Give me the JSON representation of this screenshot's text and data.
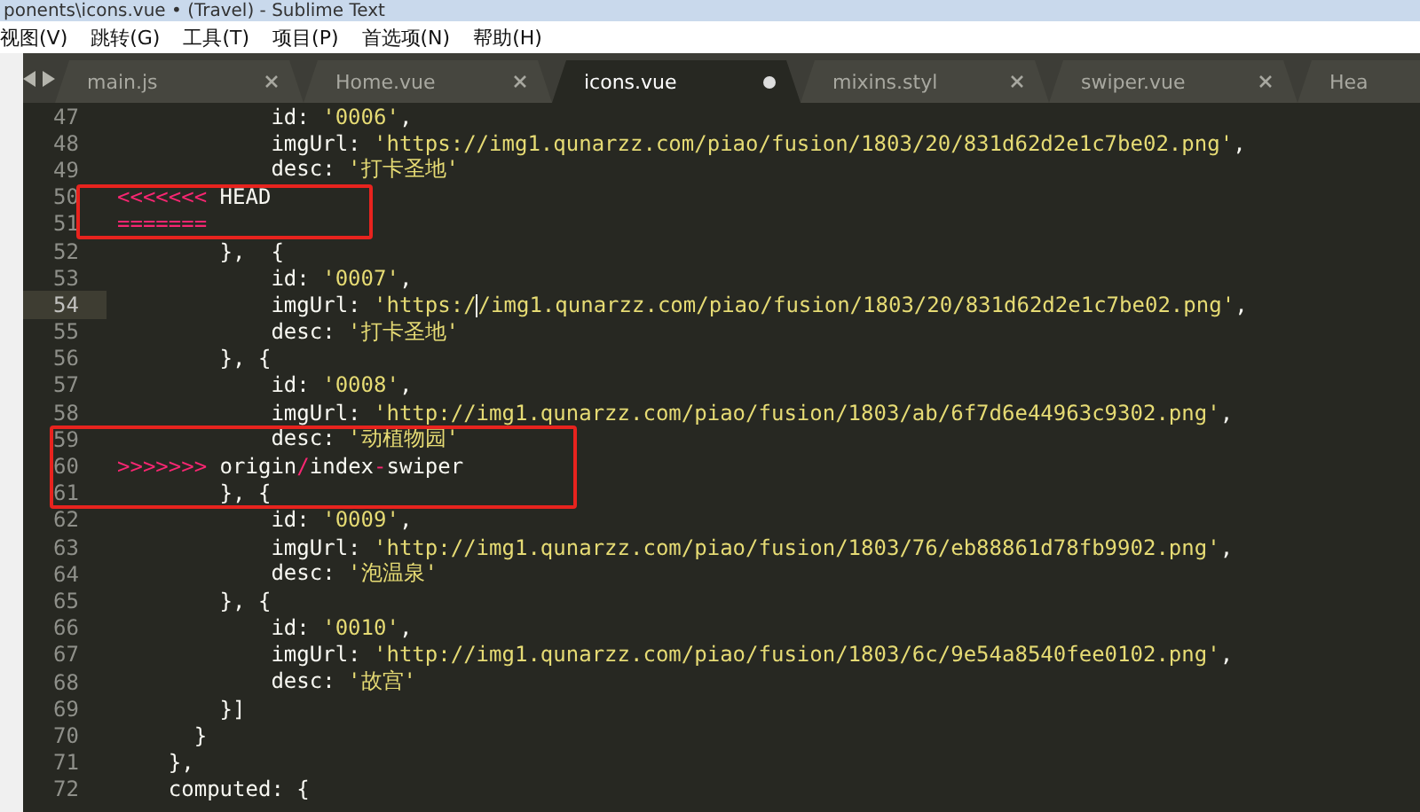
{
  "window": {
    "title": "ponents\\icons.vue • (Travel) - Sublime Text"
  },
  "menu": [
    {
      "label": "视图(V)"
    },
    {
      "label": "跳转(G)"
    },
    {
      "label": "工具(T)"
    },
    {
      "label": "项目(P)"
    },
    {
      "label": "首选项(N)"
    },
    {
      "label": "帮助(H)"
    }
  ],
  "tabs": [
    {
      "label": "main.js",
      "selected": false,
      "dirty": false
    },
    {
      "label": "Home.vue",
      "selected": false,
      "dirty": false
    },
    {
      "label": "icons.vue",
      "selected": true,
      "dirty": true
    },
    {
      "label": "mixins.styl",
      "selected": false,
      "dirty": false
    },
    {
      "label": "swiper.vue",
      "selected": false,
      "dirty": false
    },
    {
      "label": "Hea",
      "selected": false
    }
  ],
  "editor": {
    "blocks": [
      {
        "boxed": false,
        "lines": [
          {
            "number": "47",
            "current": false,
            "tokens": [
              {
                "text": "            id: ",
                "kind": "plain"
              },
              {
                "text": "'0006'",
                "kind": "string"
              },
              {
                "text": ",",
                "kind": "plain"
              }
            ]
          },
          {
            "number": "48",
            "current": false,
            "tokens": [
              {
                "text": "            imgUrl: ",
                "kind": "plain"
              },
              {
                "text": "'https://img1.qunarzz.com/piao/fusion/1803/20/831d62d2e1c7be02.png'",
                "kind": "string"
              },
              {
                "text": ",",
                "kind": "plain"
              }
            ]
          },
          {
            "number": "49",
            "current": false,
            "tokens": [
              {
                "text": "            desc: ",
                "kind": "plain"
              },
              {
                "text": "'打卡圣地'",
                "kind": "string"
              }
            ]
          }
        ]
      },
      {
        "boxed": true,
        "lines": [
          {
            "number": "50",
            "current": false,
            "tokens": [
              {
                "text": "<<<<<<<",
                "kind": "marker"
              },
              {
                "text": " HEAD",
                "kind": "plain"
              }
            ]
          },
          {
            "number": "51",
            "current": false,
            "tokens": [
              {
                "text": "=======",
                "kind": "marker"
              }
            ]
          }
        ]
      },
      {
        "boxed": false,
        "lines": [
          {
            "number": "52",
            "current": false,
            "tokens": [
              {
                "text": "        },  {",
                "kind": "plain"
              }
            ]
          },
          {
            "number": "53",
            "current": false,
            "tokens": [
              {
                "text": "            id: ",
                "kind": "plain"
              },
              {
                "text": "'0007'",
                "kind": "string"
              },
              {
                "text": ",",
                "kind": "plain"
              }
            ]
          },
          {
            "number": "54",
            "current": true,
            "tokens": [
              {
                "text": "            imgUrl: ",
                "kind": "plain"
              },
              {
                "text": "'https:/",
                "kind": "string"
              },
              {
                "text": "/img1.qunarzz.com/piao/fusion/1803/20/831d62d2e1c7be02.png'",
                "kind": "string",
                "caret_before": true
              },
              {
                "text": ",",
                "kind": "plain"
              }
            ]
          },
          {
            "number": "55",
            "current": false,
            "tokens": [
              {
                "text": "            desc: ",
                "kind": "plain"
              },
              {
                "text": "'打卡圣地'",
                "kind": "string"
              }
            ]
          },
          {
            "number": "56",
            "current": false,
            "tokens": [
              {
                "text": "        }, {",
                "kind": "plain"
              }
            ]
          },
          {
            "number": "57",
            "current": false,
            "tokens": [
              {
                "text": "            id: ",
                "kind": "plain"
              },
              {
                "text": "'0008'",
                "kind": "string"
              },
              {
                "text": ",",
                "kind": "plain"
              }
            ]
          },
          {
            "number": "58",
            "current": false,
            "tokens": [
              {
                "text": "            imgUrl: ",
                "kind": "plain"
              },
              {
                "text": "'http://img1.qunarzz.com/piao/fusion/1803/ab/6f7d6e44963c9302.png'",
                "kind": "string"
              },
              {
                "text": ",",
                "kind": "plain"
              }
            ]
          }
        ]
      },
      {
        "boxed": true,
        "lines": [
          {
            "number": "59",
            "current": false,
            "tokens": [
              {
                "text": "            desc: ",
                "kind": "plain"
              },
              {
                "text": "'动植物园'",
                "kind": "string"
              }
            ]
          },
          {
            "number": "60",
            "current": false,
            "tokens": [
              {
                "text": ">>>>>>>",
                "kind": "marker"
              },
              {
                "text": " origin",
                "kind": "plain"
              },
              {
                "text": "/",
                "kind": "marker"
              },
              {
                "text": "index",
                "kind": "plain"
              },
              {
                "text": "-",
                "kind": "marker"
              },
              {
                "text": "swiper",
                "kind": "plain"
              }
            ]
          },
          {
            "number": "61",
            "current": false,
            "tokens": [
              {
                "text": "        }, {",
                "kind": "plain"
              }
            ]
          }
        ]
      },
      {
        "boxed": false,
        "lines": [
          {
            "number": "62",
            "current": false,
            "tokens": [
              {
                "text": "            id: ",
                "kind": "plain"
              },
              {
                "text": "'0009'",
                "kind": "string"
              },
              {
                "text": ",",
                "kind": "plain"
              }
            ]
          },
          {
            "number": "63",
            "current": false,
            "tokens": [
              {
                "text": "            imgUrl: ",
                "kind": "plain"
              },
              {
                "text": "'http://img1.qunarzz.com/piao/fusion/1803/76/eb88861d78fb9902.png'",
                "kind": "string"
              },
              {
                "text": ",",
                "kind": "plain"
              }
            ]
          },
          {
            "number": "64",
            "current": false,
            "tokens": [
              {
                "text": "            desc: ",
                "kind": "plain"
              },
              {
                "text": "'泡温泉'",
                "kind": "string"
              }
            ]
          },
          {
            "number": "65",
            "current": false,
            "tokens": [
              {
                "text": "        }, {",
                "kind": "plain"
              }
            ]
          },
          {
            "number": "66",
            "current": false,
            "tokens": [
              {
                "text": "            id: ",
                "kind": "plain"
              },
              {
                "text": "'0010'",
                "kind": "string"
              },
              {
                "text": ",",
                "kind": "plain"
              }
            ]
          },
          {
            "number": "67",
            "current": false,
            "tokens": [
              {
                "text": "            imgUrl: ",
                "kind": "plain"
              },
              {
                "text": "'http://img1.qunarzz.com/piao/fusion/1803/6c/9e54a8540fee0102.png'",
                "kind": "string"
              },
              {
                "text": ",",
                "kind": "plain"
              }
            ]
          },
          {
            "number": "68",
            "current": false,
            "tokens": [
              {
                "text": "            desc: ",
                "kind": "plain"
              },
              {
                "text": "'故宫'",
                "kind": "string"
              }
            ]
          },
          {
            "number": "69",
            "current": false,
            "tokens": [
              {
                "text": "        }]",
                "kind": "plain"
              }
            ]
          },
          {
            "number": "70",
            "current": false,
            "tokens": [
              {
                "text": "      }",
                "kind": "plain"
              }
            ]
          },
          {
            "number": "71",
            "current": false,
            "tokens": [
              {
                "text": "    },",
                "kind": "plain"
              }
            ]
          },
          {
            "number": "72",
            "current": false,
            "tokens": [
              {
                "text": "    computed: {",
                "kind": "plain"
              }
            ]
          }
        ]
      }
    ]
  }
}
